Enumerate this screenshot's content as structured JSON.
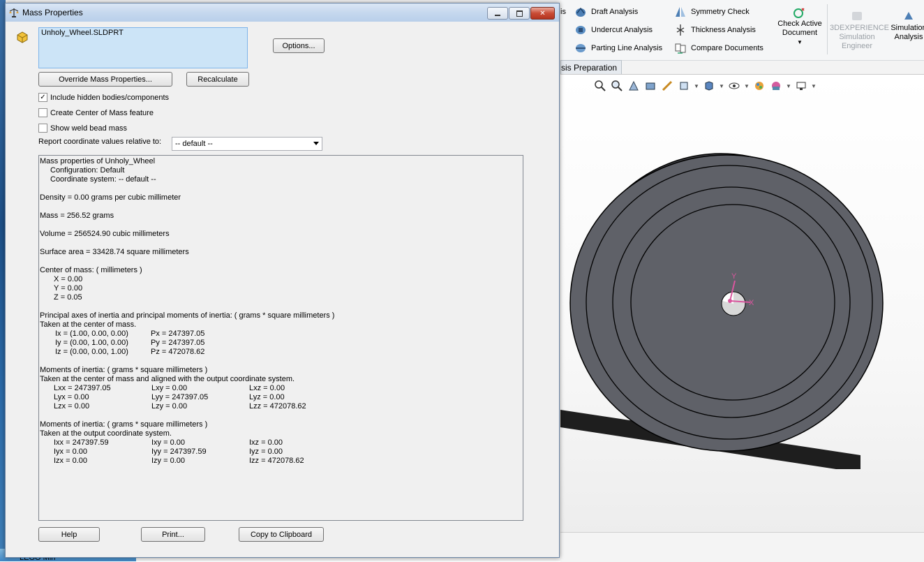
{
  "dialog": {
    "title": "Mass Properties",
    "file_name": "Unholy_Wheel.SLDPRT",
    "options_label": "Options...",
    "override_label": "Override Mass Properties...",
    "recalculate_label": "Recalculate",
    "checkbox_hidden": "Include hidden bodies/components",
    "checkbox_center": "Create Center of Mass feature",
    "checkbox_weld": "Show weld bead mass",
    "coord_label": "Report coordinate values relative to:",
    "coord_value": "-- default --",
    "help_label": "Help",
    "print_label": "Print...",
    "copy_label": "Copy to Clipboard",
    "checked": {
      "hidden": true,
      "center": false,
      "weld": false
    }
  },
  "report": {
    "header": "Mass properties of Unholy_Wheel",
    "config": "Configuration: Default",
    "coord": "Coordinate system: -- default --",
    "density": "Density = 0.00 grams per cubic millimeter",
    "mass": "Mass = 256.52 grams",
    "volume": "Volume = 256524.90 cubic millimeters",
    "surface": "Surface area = 33428.74  square millimeters",
    "com_title": "Center of mass: ( millimeters )",
    "com_x": "X = 0.00",
    "com_y": "Y = 0.00",
    "com_z": "Z = 0.05",
    "pa_title": "Principal axes of inertia and principal moments of inertia: ( grams *  square millimeters )",
    "pa_sub": "Taken at the center of mass.",
    "ix": "Ix = (1.00,  0.00,  0.00)",
    "iy": "Iy = (0.00,  1.00,  0.00)",
    "iz": "Iz = (0.00,  0.00,  1.00)",
    "px": "Px = 247397.05",
    "py": "Py = 247397.05",
    "pz": "Pz = 472078.62",
    "mi1_title": "Moments of inertia: ( grams *  square millimeters )",
    "mi1_sub": "Taken at the center of mass and aligned with the output coordinate system.",
    "lxx": "Lxx = 247397.05",
    "lxy": "Lxy = 0.00",
    "lxz": "Lxz = 0.00",
    "lyx": "Lyx = 0.00",
    "lyy": "Lyy = 247397.05",
    "lyz": "Lyz = 0.00",
    "lzx": "Lzx = 0.00",
    "lzy": "Lzy = 0.00",
    "lzz": "Lzz = 472078.62",
    "mi2_title": "Moments of inertia: ( grams *  square millimeters )",
    "mi2_sub": "Taken at the output coordinate system.",
    "ixx": "Ixx = 247397.59",
    "ixy": "Ixy = 0.00",
    "ixz": "Ixz = 0.00",
    "iyx": "Iyx = 0.00",
    "iyy": "Iyy = 247397.59",
    "iyz": "Iyz = 0.00",
    "izx": "Izx = 0.00",
    "izy": "Izy = 0.00",
    "izz": "Izz = 472078.62"
  },
  "ribbon": {
    "partial": "is",
    "draft": "Draft Analysis",
    "undercut": "Undercut Analysis",
    "parting": "Parting Line Analysis",
    "symmetry": "Symmetry Check",
    "thickness": "Thickness Analysis",
    "compare": "Compare Documents",
    "check_active": "Check Active Document",
    "threed": "3DEXPERIENCE Simulation Engineer",
    "simulation": "Simulation Analysis"
  },
  "tab": {
    "label": "sis Preparation"
  },
  "taskbar": {
    "label": "LEGO Min"
  },
  "triad": {
    "y": "Y",
    "x": "X"
  },
  "colors": {
    "accent": "#cce4f7",
    "wheel": "#5f6168",
    "triad": "#d9569e"
  }
}
